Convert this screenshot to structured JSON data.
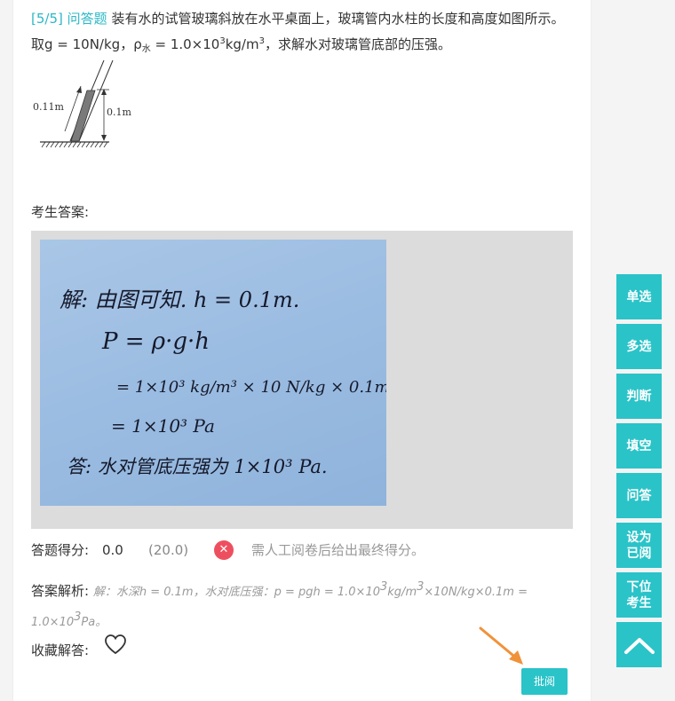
{
  "question": {
    "number": "[5/5]",
    "type": "问答题",
    "text_part1": "装有水的试管玻璃斜放在水平桌面上，玻璃管内水柱的长度和高度如图所示。取g = 10N/kg，ρ",
    "rho_sub": "水",
    "text_part2": " = 1.0×10",
    "exp": "3",
    "text_part3": "kg/m",
    "exp2": "3",
    "text_part4": "，求解水对玻璃管底部的压强。",
    "diagram": {
      "length_label": "0.11m",
      "height_label": "0.1m"
    }
  },
  "answer_label": "考生答案:",
  "handwriting": {
    "line1": "解: 由图可知. h = 0.1m.",
    "line2": "P = ρ·g·h",
    "line3": "= 1×10³ kg/m³ × 10 N/kg × 0.1m",
    "line4": "= 1×10³ Pa",
    "line5": "答: 水对管底压强为 1×10³ Pa."
  },
  "score": {
    "label": "答题得分:",
    "value": "0.0",
    "total": "(20.0)",
    "note": "需人工阅卷后给出最终得分。"
  },
  "analysis": {
    "label": "答案解析:",
    "text_a": "解：水深h = 0.1m，水对底压强：p = pgh = 1.0×10",
    "exp1": "3",
    "text_b": "kg/m",
    "exp2": "3",
    "text_c": "×10N/kg×0.1m = 1.0×10",
    "exp3": "3",
    "text_d": "Pa。"
  },
  "favorite_label": "收藏解答:",
  "review_button": "批阅",
  "sidebar": {
    "items": [
      "单选",
      "多选",
      "判断",
      "填空",
      "问答",
      "设为已阅",
      "下位考生"
    ]
  },
  "colors": {
    "accent": "#2ac3c8",
    "error": "#ee4f5f",
    "link": "#2bb8c6"
  }
}
